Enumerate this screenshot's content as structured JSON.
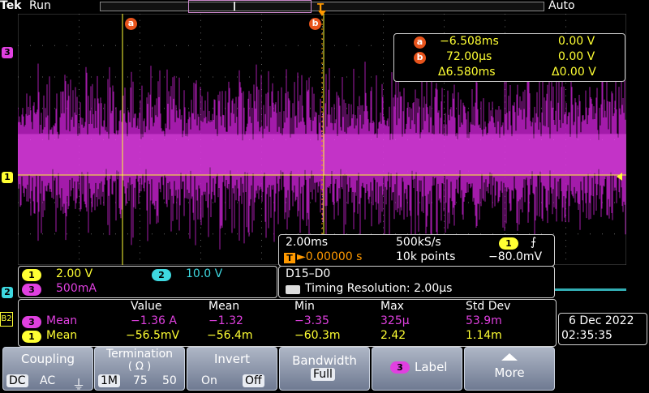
{
  "status": {
    "brand": "Tek",
    "run_state": "Run",
    "trigger_mode": "Auto"
  },
  "markers": {
    "ch3": "3",
    "ch1": "1",
    "ch2": "2",
    "cursor_a": "a",
    "cursor_b": "b",
    "trigger": "T"
  },
  "cursors": {
    "a_label": "a",
    "a_time": "−6.508ms",
    "a_volt": "0.00 V",
    "b_label": "b",
    "b_time": "72.00µs",
    "b_volt": "0.00 V",
    "delta_time": "Δ6.580ms",
    "delta_volt": "Δ0.00 V"
  },
  "timebase": {
    "scale": "2.00ms",
    "sample_rate": "500kS/s",
    "trig_channel": "1",
    "trig_position": "►0.00000 s",
    "record_length": "10k points",
    "trig_level": "−80.0mV"
  },
  "channels": {
    "ch1_num": "1",
    "ch1_scale": "2.00 V",
    "ch2_num": "2",
    "ch2_scale": "10.0 V",
    "ch3_num": "3",
    "ch3_scale": "500mA"
  },
  "bus": {
    "name": "D15–D0",
    "timing": "Timing Resolution: 2.00µs",
    "bus_marker": "B2"
  },
  "measurements": {
    "headers": [
      "Value",
      "Mean",
      "Min",
      "Max",
      "Std Dev"
    ],
    "rows": [
      {
        "channel": "3",
        "label": "Mean",
        "values": [
          "−1.36 A",
          "−1.32",
          "−3.35",
          "325µ",
          "53.9m"
        ]
      },
      {
        "channel": "1",
        "label": "Mean",
        "values": [
          "−56.5mV",
          "−56.4m",
          "−60.3m",
          "2.42",
          "1.14m"
        ]
      }
    ]
  },
  "datetime": {
    "date": "6 Dec 2022",
    "time": "02:35:35"
  },
  "menu": {
    "coupling": {
      "title": "Coupling",
      "options": [
        "DC",
        "AC",
        "⏚"
      ]
    },
    "termination": {
      "title": "Termination",
      "subtitle": "( Ω )",
      "options": [
        "1M",
        "75",
        "50"
      ]
    },
    "invert": {
      "title": "Invert",
      "options": [
        "On",
        "Off"
      ]
    },
    "bandwidth": {
      "title": "Bandwidth",
      "value": "Full"
    },
    "label": {
      "channel": "3",
      "title": "Label"
    },
    "more": {
      "title": "More"
    }
  },
  "colors": {
    "ch1": "#ffff33",
    "ch2": "#3ed8e0",
    "ch3": "#e040e0",
    "cursor_badge": "#e8541c"
  },
  "waveform": {
    "ch3_mean_level_div": 0.3,
    "ch2_level_div": -3.6
  }
}
